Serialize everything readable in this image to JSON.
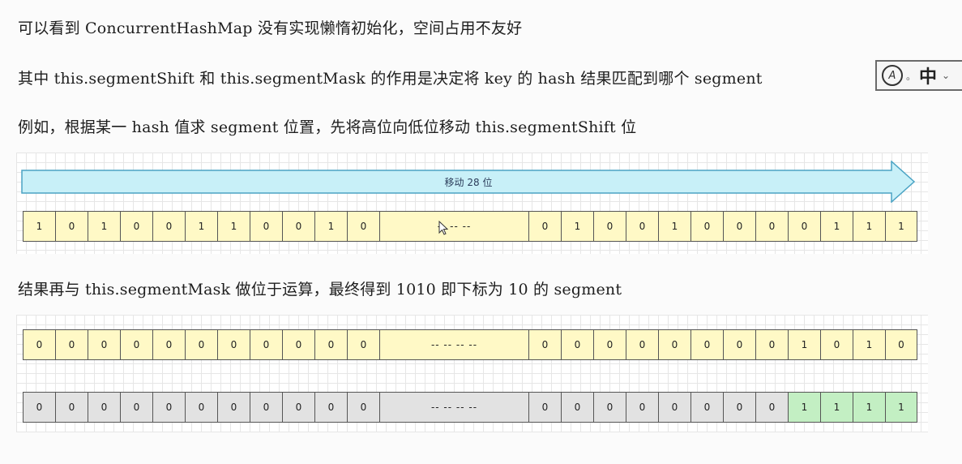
{
  "text_lines": {
    "line1": "可以看到 ConcurrentHashMap 没有实现懒惰初始化，空间占用不友好",
    "line2": "其中 this.segmentShift 和 this.segmentMask 的作用是决定将 key 的 hash 结果匹配到哪个 segment",
    "line3": "例如，根据某一 hash 值求 segment 位置，先将高位向低位移动 this.segmentShift 位",
    "line4": "结果再与 this.segmentMask 做位于运算，最终得到 1010 即下标为 10 的 segment"
  },
  "arrow": {
    "label": "移动 28 位",
    "color": "#c8f0f8"
  },
  "rows": {
    "row1": {
      "left_bits": [
        "1",
        "0",
        "1",
        "0",
        "0",
        "1",
        "1",
        "0",
        "0",
        "1",
        "0"
      ],
      "middle": "-- -- --",
      "right_bits": [
        "0",
        "1",
        "0",
        "0",
        "1",
        "0",
        "0",
        "0",
        "0",
        "1",
        "1",
        "1"
      ]
    },
    "row2": {
      "left_bits": [
        "0",
        "0",
        "0",
        "0",
        "0",
        "0",
        "0",
        "0",
        "0",
        "0",
        "0"
      ],
      "middle": "-- -- -- --",
      "right_bits": [
        "0",
        "0",
        "0",
        "0",
        "0",
        "0",
        "0",
        "0",
        "1",
        "0",
        "1",
        "0"
      ]
    },
    "row3": {
      "left_bits": [
        "0",
        "0",
        "0",
        "0",
        "0",
        "0",
        "0",
        "0",
        "0",
        "0",
        "0"
      ],
      "middle": "-- -- -- --",
      "right_bits": [
        "0",
        "0",
        "0",
        "0",
        "0",
        "0",
        "0",
        "0",
        "1",
        "1",
        "1",
        "1"
      ]
    }
  },
  "colors": {
    "yellow": "#fff9c6",
    "gray": "#e2e2e2",
    "green": "#c3efc3"
  },
  "ime": {
    "logo": "A",
    "separator": "。",
    "language": "中",
    "more": "⌄",
    "icon": "input-method-icon"
  }
}
